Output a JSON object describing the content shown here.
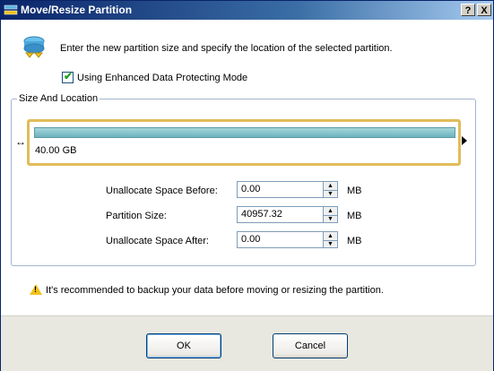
{
  "window": {
    "title": "Move/Resize Partition",
    "help_label": "?",
    "close_label": "X"
  },
  "instruction": "Enter the new partition size and specify the location of the selected partition.",
  "enhanced_mode": {
    "label": "Using Enhanced Data Protecting Mode",
    "checked": true,
    "check_glyph": "✔"
  },
  "size_location": {
    "group_label": "Size And Location",
    "partition_size_label": "40.00 GB",
    "left_handle_glyph": "↔"
  },
  "fields": [
    {
      "label": "Unallocate Space Before:",
      "value": "0.00",
      "unit": "MB"
    },
    {
      "label": "Partition Size:",
      "value": "40957.32",
      "unit": "MB"
    },
    {
      "label": "Unallocate Space After:",
      "value": "0.00",
      "unit": "MB"
    }
  ],
  "spin_glyphs": {
    "up": "▲",
    "down": "▼"
  },
  "warning": {
    "mark": "!",
    "text": "It's recommended to backup your data before moving or resizing the partition."
  },
  "buttons": {
    "ok": "OK",
    "cancel": "Cancel"
  },
  "colors": {
    "titlebar_start": "#0a246a",
    "partition_bar": "#6db2bd",
    "selection_border": "#e0bc5a",
    "footer_bg": "#e8e8e0"
  }
}
